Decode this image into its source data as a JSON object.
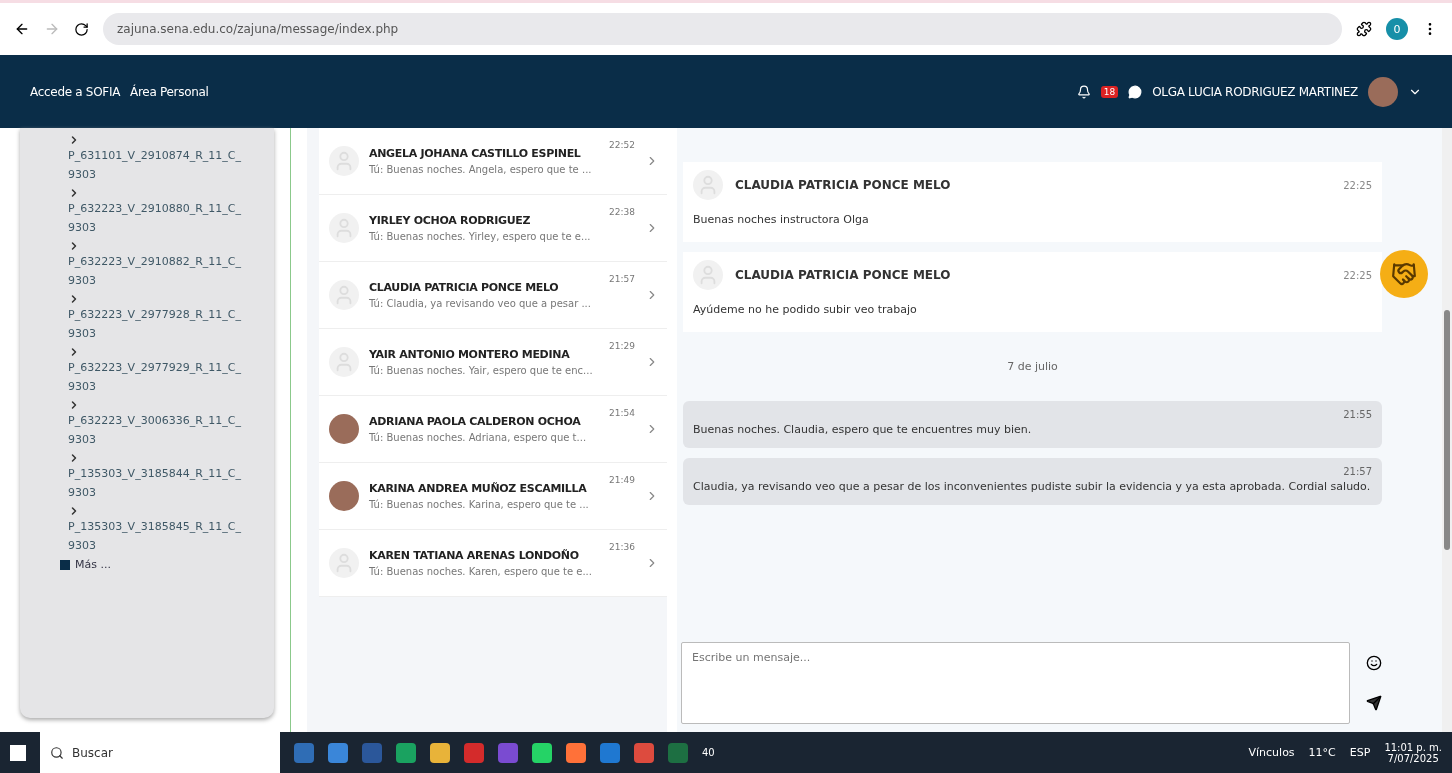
{
  "browser": {
    "url": "zajuna.sena.edu.co/zajuna/message/index.php",
    "profile": "0"
  },
  "navbar": {
    "links": [
      "Accede a SOFIA",
      "Área Personal"
    ],
    "notifications": "18",
    "user": "OLGA LUCIA RODRIGUEZ MARTINEZ"
  },
  "sidebar": {
    "items": [
      "P_631101_V_2910874_R_11_C_9303",
      "P_632223_V_2910880_R_11_C_9303",
      "P_632223_V_2910882_R_11_C_9303",
      "P_632223_V_2977928_R_11_C_9303",
      "P_632223_V_2977929_R_11_C_9303",
      "P_632223_V_3006336_R_11_C_9303",
      "P_135303_V_3185844_R_11_C_9303",
      "P_135303_V_3185845_R_11_C_9303"
    ],
    "more": "Más ..."
  },
  "contacts": [
    {
      "name": "ANGELA JOHANA CASTILLO ESPINEL",
      "time": "22:52",
      "preview": "Tú: Buenas noches. Angela, espero que te ...",
      "photo": false
    },
    {
      "name": "YIRLEY OCHOA RODRIGUEZ",
      "time": "22:38",
      "preview": "Tú: Buenas noches. Yirley, espero que te e...",
      "photo": false
    },
    {
      "name": "CLAUDIA PATRICIA PONCE MELO",
      "time": "21:57",
      "preview": "Tú: Claudia, ya revisando veo que a pesar ...",
      "photo": false
    },
    {
      "name": "YAIR ANTONIO MONTERO MEDINA",
      "time": "21:29",
      "preview": "Tú: Buenas noches. Yair, espero que te enc...",
      "photo": false
    },
    {
      "name": "ADRIANA PAOLA CALDERON OCHOA",
      "time": "21:54",
      "preview": "Tú: Buenas noches. Adriana, espero que t...",
      "photo": true
    },
    {
      "name": "KARINA ANDREA MUÑOZ ESCAMILLA",
      "time": "21:49",
      "preview": "Tú: Buenas noches. Karina, espero que te ...",
      "photo": true
    },
    {
      "name": "KAREN TATIANA ARENAS LONDOÑO",
      "time": "21:36",
      "preview": "Tú: Buenas noches. Karen, espero que te e...",
      "photo": false
    }
  ],
  "messages": [
    {
      "kind": "received",
      "sender": "CLAUDIA PATRICIA PONCE MELO",
      "time": "22:25",
      "text": "Buenas noches instructora Olga"
    },
    {
      "kind": "received",
      "sender": "CLAUDIA PATRICIA PONCE MELO",
      "time": "22:25",
      "text": "Ayúdeme no he podido subir veo trabajo"
    },
    {
      "kind": "date",
      "text": "7 de julio"
    },
    {
      "kind": "sent",
      "time": "21:55",
      "text": "Buenas noches. Claudia, espero que te encuentres muy bien."
    },
    {
      "kind": "sent",
      "time": "21:57",
      "text": "Claudia, ya revisando veo que a pesar de los inconvenientes pudiste subir la evidencia y ya esta aprobada. Cordial saludo."
    }
  ],
  "composer": {
    "placeholder": "Escribe un mensaje..."
  },
  "taskbar": {
    "search": "Buscar",
    "whatsapp_badge": "40",
    "links": "Vínculos",
    "weather": "11°C",
    "language": "ESP",
    "time": "11:01 p. m.",
    "date": "7/07/2025"
  }
}
